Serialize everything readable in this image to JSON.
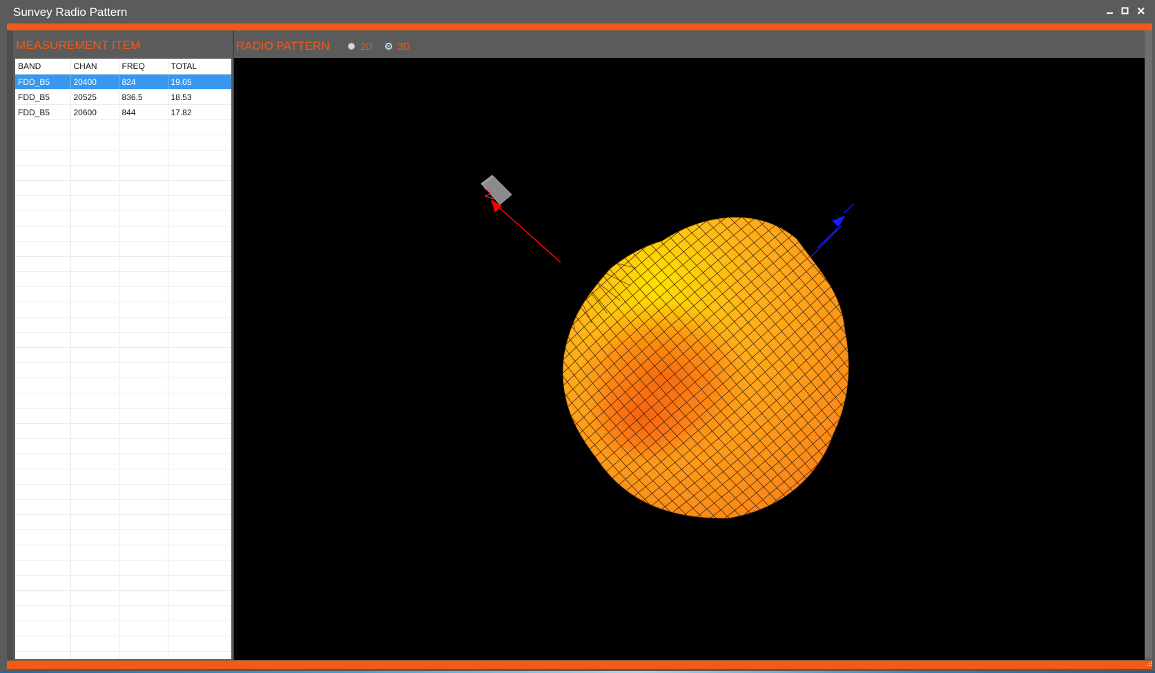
{
  "window": {
    "title": "Sunvey Radio Pattern",
    "accent_color": "#f35a17",
    "controls": [
      "minimize-icon",
      "maximize-icon",
      "close-icon"
    ]
  },
  "measurement": {
    "title": "MEASUREMENT ITEM",
    "columns": [
      "BAND",
      "CHAN",
      "FREQ",
      "TOTAL"
    ],
    "rows": [
      {
        "band": "FDD_B5",
        "chan": "20400",
        "freq": "824",
        "total": "19.05",
        "selected": true
      },
      {
        "band": "FDD_B5",
        "chan": "20525",
        "freq": "836.5",
        "total": "18.53",
        "selected": false
      },
      {
        "band": "FDD_B5",
        "chan": "20600",
        "freq": "844",
        "total": "17.82",
        "selected": false
      }
    ],
    "selected_color": "#3898f0"
  },
  "radio_pattern": {
    "title": "RADIO PATTERN",
    "modes": [
      {
        "label": "2D",
        "selected": false
      },
      {
        "label": "3D",
        "selected": true
      }
    ],
    "surface_colors": [
      "#ffe000",
      "#ffa11a",
      "#f5620f"
    ],
    "axis_colors": {
      "red_axis": "#ff0000",
      "blue_axis": "#1a1aff"
    }
  }
}
